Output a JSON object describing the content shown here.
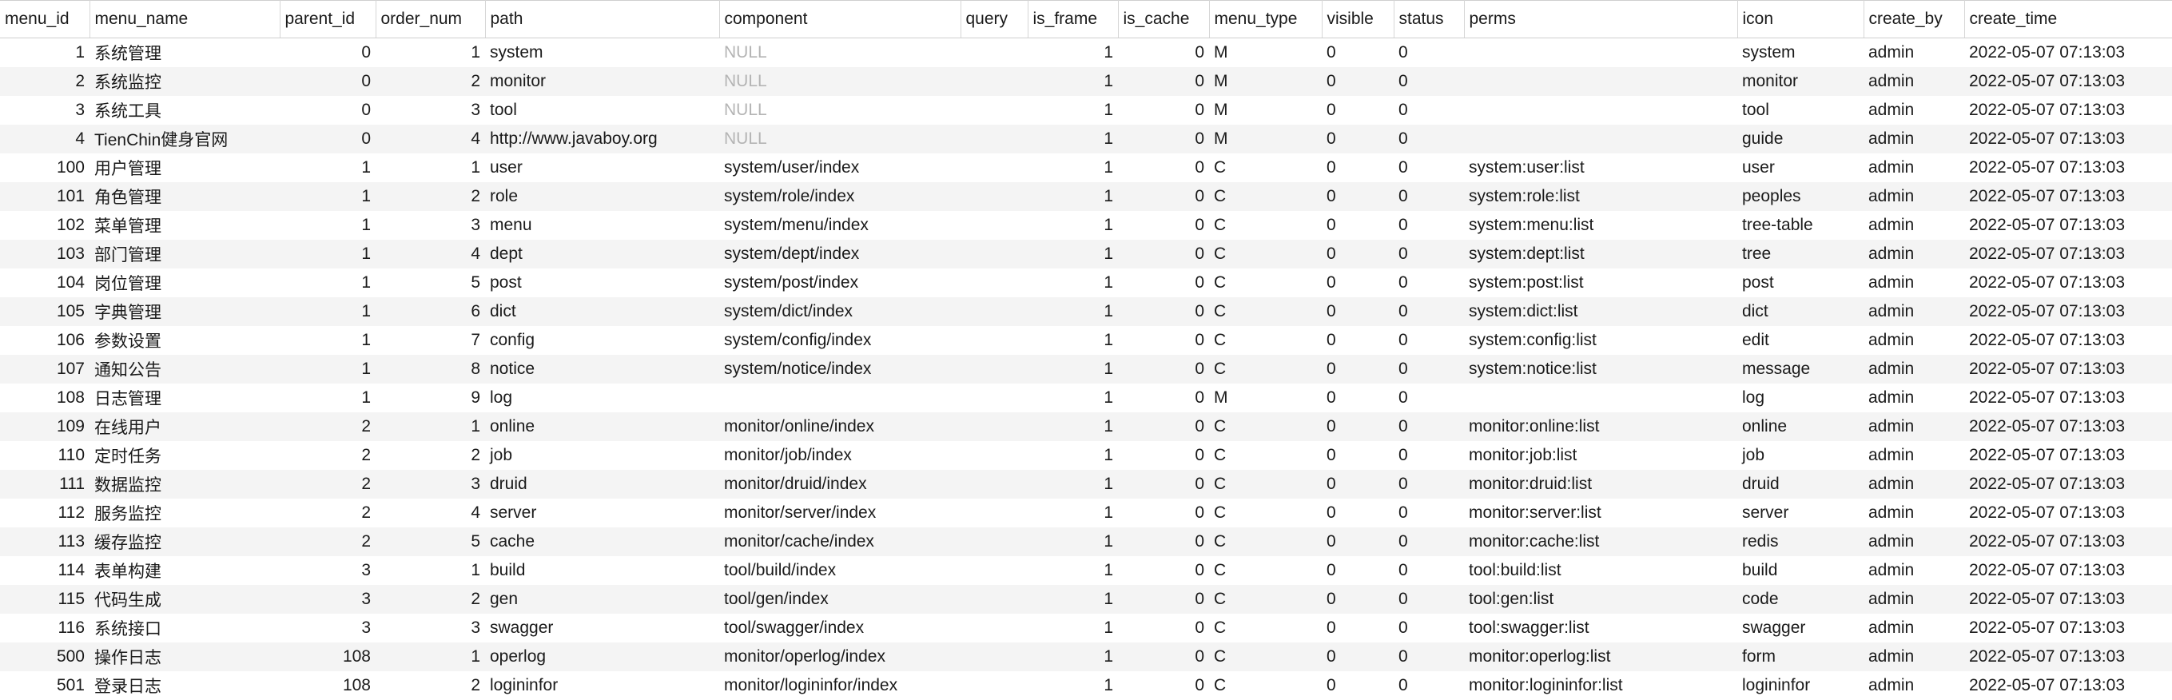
{
  "table": {
    "columns": [
      {
        "key": "menu_id",
        "label": "menu_id",
        "align": "num"
      },
      {
        "key": "menu_name",
        "label": "menu_name",
        "align": "txt"
      },
      {
        "key": "parent_id",
        "label": "parent_id",
        "align": "num"
      },
      {
        "key": "order_num",
        "label": "order_num",
        "align": "num"
      },
      {
        "key": "path",
        "label": "path",
        "align": "txt"
      },
      {
        "key": "component",
        "label": "component",
        "align": "txt"
      },
      {
        "key": "query",
        "label": "query",
        "align": "txt"
      },
      {
        "key": "is_frame",
        "label": "is_frame",
        "align": "num"
      },
      {
        "key": "is_cache",
        "label": "is_cache",
        "align": "num"
      },
      {
        "key": "menu_type",
        "label": "menu_type",
        "align": "txt"
      },
      {
        "key": "visible",
        "label": "visible",
        "align": "txt"
      },
      {
        "key": "status",
        "label": "status",
        "align": "txt"
      },
      {
        "key": "perms",
        "label": "perms",
        "align": "txt"
      },
      {
        "key": "icon",
        "label": "icon",
        "align": "txt"
      },
      {
        "key": "create_by",
        "label": "create_by",
        "align": "txt"
      },
      {
        "key": "create_time",
        "label": "create_time",
        "align": "txt"
      }
    ],
    "rows": [
      [
        "1",
        "系统管理",
        "0",
        "1",
        "system",
        "NULL",
        "",
        "1",
        "0",
        "M",
        "0",
        "0",
        "",
        "system",
        "admin",
        "2022-05-07 07:13:03"
      ],
      [
        "2",
        "系统监控",
        "0",
        "2",
        "monitor",
        "NULL",
        "",
        "1",
        "0",
        "M",
        "0",
        "0",
        "",
        "monitor",
        "admin",
        "2022-05-07 07:13:03"
      ],
      [
        "3",
        "系统工具",
        "0",
        "3",
        "tool",
        "NULL",
        "",
        "1",
        "0",
        "M",
        "0",
        "0",
        "",
        "tool",
        "admin",
        "2022-05-07 07:13:03"
      ],
      [
        "4",
        "TienChin健身官网",
        "0",
        "4",
        "http://www.javaboy.org",
        "NULL",
        "",
        "1",
        "0",
        "M",
        "0",
        "0",
        "",
        "guide",
        "admin",
        "2022-05-07 07:13:03"
      ],
      [
        "100",
        "用户管理",
        "1",
        "1",
        "user",
        "system/user/index",
        "",
        "1",
        "0",
        "C",
        "0",
        "0",
        "system:user:list",
        "user",
        "admin",
        "2022-05-07 07:13:03"
      ],
      [
        "101",
        "角色管理",
        "1",
        "2",
        "role",
        "system/role/index",
        "",
        "1",
        "0",
        "C",
        "0",
        "0",
        "system:role:list",
        "peoples",
        "admin",
        "2022-05-07 07:13:03"
      ],
      [
        "102",
        "菜单管理",
        "1",
        "3",
        "menu",
        "system/menu/index",
        "",
        "1",
        "0",
        "C",
        "0",
        "0",
        "system:menu:list",
        "tree-table",
        "admin",
        "2022-05-07 07:13:03"
      ],
      [
        "103",
        "部门管理",
        "1",
        "4",
        "dept",
        "system/dept/index",
        "",
        "1",
        "0",
        "C",
        "0",
        "0",
        "system:dept:list",
        "tree",
        "admin",
        "2022-05-07 07:13:03"
      ],
      [
        "104",
        "岗位管理",
        "1",
        "5",
        "post",
        "system/post/index",
        "",
        "1",
        "0",
        "C",
        "0",
        "0",
        "system:post:list",
        "post",
        "admin",
        "2022-05-07 07:13:03"
      ],
      [
        "105",
        "字典管理",
        "1",
        "6",
        "dict",
        "system/dict/index",
        "",
        "1",
        "0",
        "C",
        "0",
        "0",
        "system:dict:list",
        "dict",
        "admin",
        "2022-05-07 07:13:03"
      ],
      [
        "106",
        "参数设置",
        "1",
        "7",
        "config",
        "system/config/index",
        "",
        "1",
        "0",
        "C",
        "0",
        "0",
        "system:config:list",
        "edit",
        "admin",
        "2022-05-07 07:13:03"
      ],
      [
        "107",
        "通知公告",
        "1",
        "8",
        "notice",
        "system/notice/index",
        "",
        "1",
        "0",
        "C",
        "0",
        "0",
        "system:notice:list",
        "message",
        "admin",
        "2022-05-07 07:13:03"
      ],
      [
        "108",
        "日志管理",
        "1",
        "9",
        "log",
        "",
        "",
        "1",
        "0",
        "M",
        "0",
        "0",
        "",
        "log",
        "admin",
        "2022-05-07 07:13:03"
      ],
      [
        "109",
        "在线用户",
        "2",
        "1",
        "online",
        "monitor/online/index",
        "",
        "1",
        "0",
        "C",
        "0",
        "0",
        "monitor:online:list",
        "online",
        "admin",
        "2022-05-07 07:13:03"
      ],
      [
        "110",
        "定时任务",
        "2",
        "2",
        "job",
        "monitor/job/index",
        "",
        "1",
        "0",
        "C",
        "0",
        "0",
        "monitor:job:list",
        "job",
        "admin",
        "2022-05-07 07:13:03"
      ],
      [
        "111",
        "数据监控",
        "2",
        "3",
        "druid",
        "monitor/druid/index",
        "",
        "1",
        "0",
        "C",
        "0",
        "0",
        "monitor:druid:list",
        "druid",
        "admin",
        "2022-05-07 07:13:03"
      ],
      [
        "112",
        "服务监控",
        "2",
        "4",
        "server",
        "monitor/server/index",
        "",
        "1",
        "0",
        "C",
        "0",
        "0",
        "monitor:server:list",
        "server",
        "admin",
        "2022-05-07 07:13:03"
      ],
      [
        "113",
        "缓存监控",
        "2",
        "5",
        "cache",
        "monitor/cache/index",
        "",
        "1",
        "0",
        "C",
        "0",
        "0",
        "monitor:cache:list",
        "redis",
        "admin",
        "2022-05-07 07:13:03"
      ],
      [
        "114",
        "表单构建",
        "3",
        "1",
        "build",
        "tool/build/index",
        "",
        "1",
        "0",
        "C",
        "0",
        "0",
        "tool:build:list",
        "build",
        "admin",
        "2022-05-07 07:13:03"
      ],
      [
        "115",
        "代码生成",
        "3",
        "2",
        "gen",
        "tool/gen/index",
        "",
        "1",
        "0",
        "C",
        "0",
        "0",
        "tool:gen:list",
        "code",
        "admin",
        "2022-05-07 07:13:03"
      ],
      [
        "116",
        "系统接口",
        "3",
        "3",
        "swagger",
        "tool/swagger/index",
        "",
        "1",
        "0",
        "C",
        "0",
        "0",
        "tool:swagger:list",
        "swagger",
        "admin",
        "2022-05-07 07:13:03"
      ],
      [
        "500",
        "操作日志",
        "108",
        "1",
        "operlog",
        "monitor/operlog/index",
        "",
        "1",
        "0",
        "C",
        "0",
        "0",
        "monitor:operlog:list",
        "form",
        "admin",
        "2022-05-07 07:13:03"
      ],
      [
        "501",
        "登录日志",
        "108",
        "2",
        "logininfor",
        "monitor/logininfor/index",
        "",
        "1",
        "0",
        "C",
        "0",
        "0",
        "monitor:logininfor:list",
        "logininfor",
        "admin",
        "2022-05-07 07:13:03"
      ]
    ]
  }
}
